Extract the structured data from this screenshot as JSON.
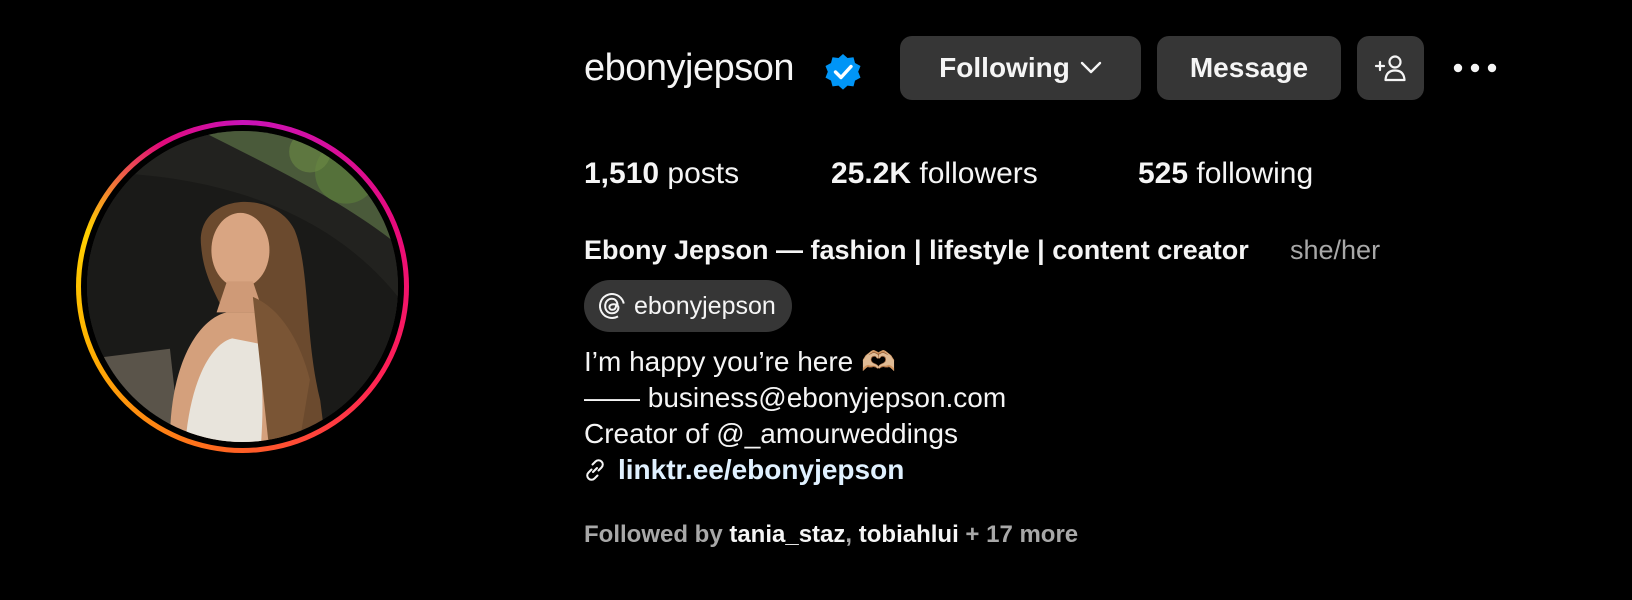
{
  "profile": {
    "username": "ebonyjepson",
    "verified": true,
    "full_name": "Ebony Jepson — fashion | lifestyle | content creator",
    "pronouns": "she/her",
    "threads_handle": "ebonyjepson",
    "bio_lines": [
      "I’m happy you’re here 🫶🏼",
      "—— business@ebonyjepson.com",
      "Creator of @_amourweddings"
    ],
    "link": "linktr.ee/ebonyjepson"
  },
  "actions": {
    "following_label": "Following",
    "message_label": "Message"
  },
  "stats": {
    "posts_count": "1,510",
    "posts_label": "posts",
    "followers_count": "25.2K",
    "followers_label": "followers",
    "following_count": "525",
    "following_label": "following"
  },
  "followed_by": {
    "prefix": "Followed by",
    "users": [
      "tania_staz",
      "tobiahlui"
    ],
    "separator": ",",
    "more": "+ 17 more"
  },
  "icons": {
    "verified": "verified-badge-icon",
    "chevron": "chevron-down-icon",
    "add_user": "add-user-icon",
    "more": "more-options-icon",
    "threads": "threads-icon",
    "link": "link-icon"
  },
  "colors": {
    "background": "#000000",
    "button": "#363636",
    "verified": "#0095f6",
    "secondary_text": "#a8a8a8",
    "link": "#e0f1ff"
  }
}
